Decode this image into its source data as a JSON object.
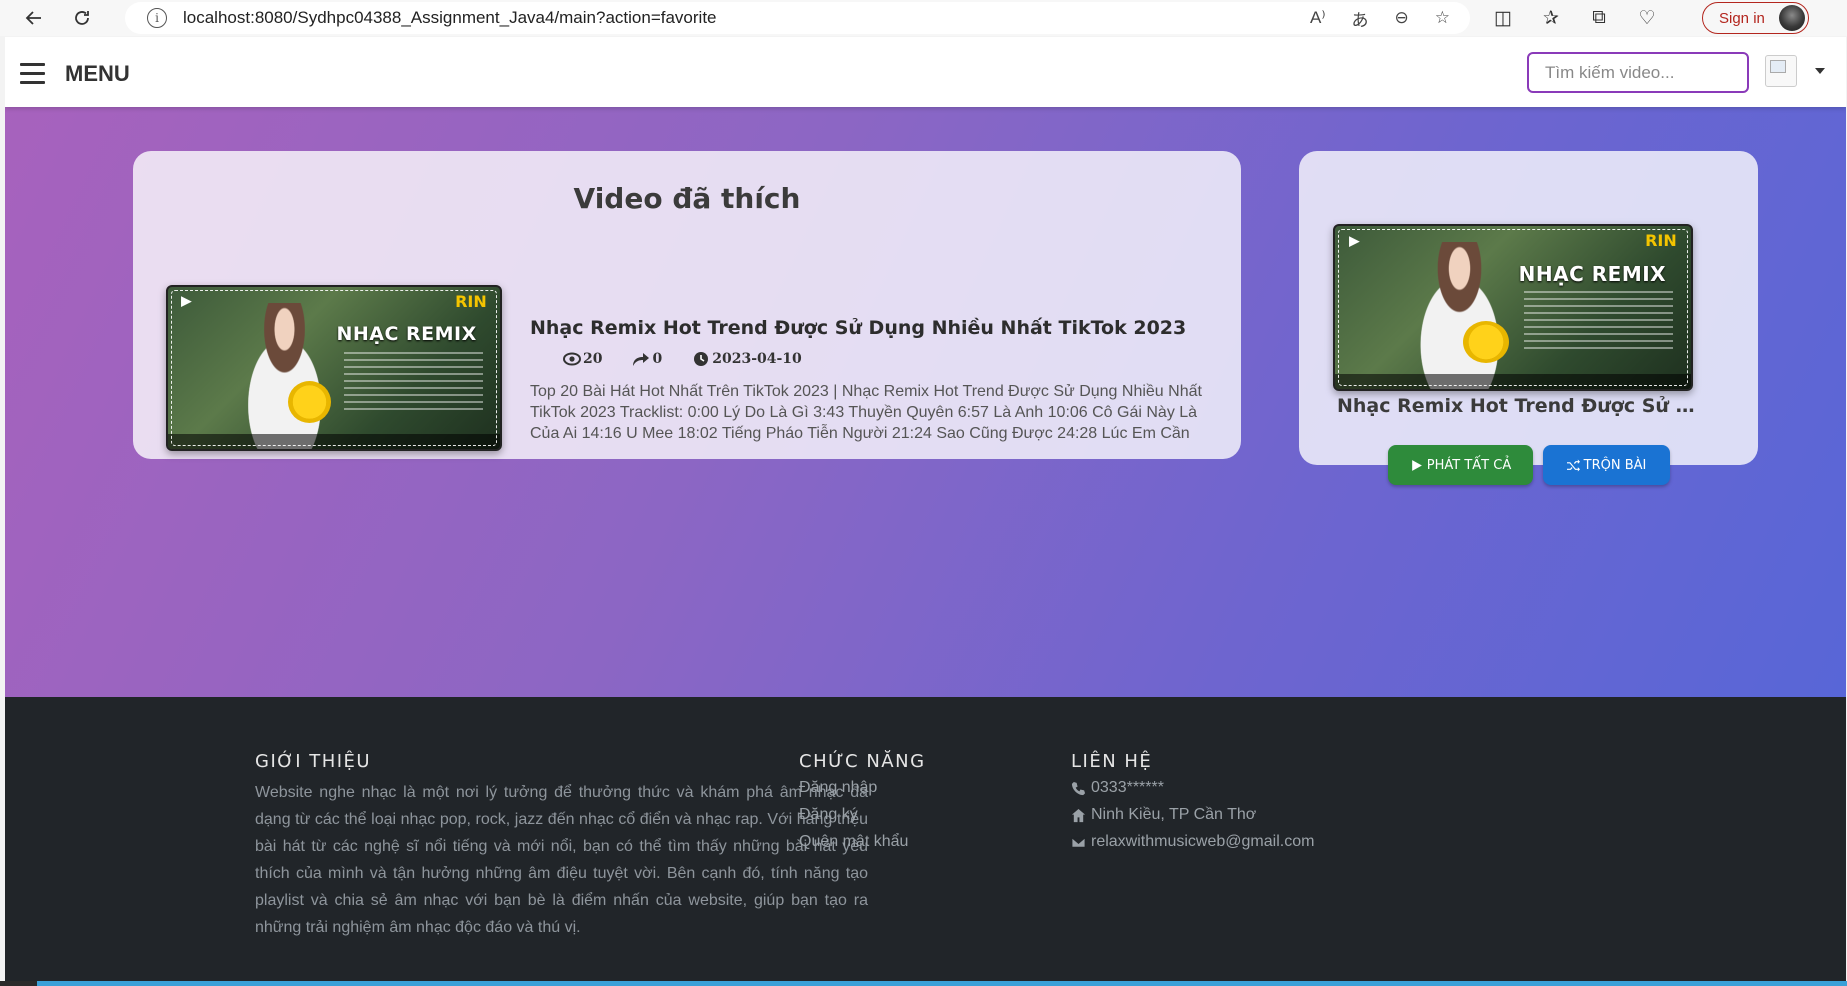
{
  "browser": {
    "url": "localhost:8080/Sydhpc04388_Assignment_Java4/main?action=favorite",
    "signin_label": "Sign in"
  },
  "navbar": {
    "menu_label": "MENU",
    "search_placeholder": "Tìm kiếm video..."
  },
  "favorites": {
    "heading": "Video đã thích",
    "video": {
      "thumbnail_title": "NHẠC REMIX",
      "thumbnail_brand": "RIN",
      "title": "Nhạc Remix Hot Trend Được Sử Dụng Nhiều Nhất TikTok 2023",
      "views": "20",
      "shares": "0",
      "date": "2023-04-10",
      "description": "Top 20 Bài Hát Hot Nhất Trên TikTok 2023 | Nhạc Remix Hot Trend Được Sử Dụng Nhiều Nhất TikTok 2023 Tracklist: 0:00 Lý Do Là Gì 3:43 Thuyền Quyên 6:57 Là Anh 10:06 Cô Gái Này Là Của Ai 14:16 U Mee 18:02 Tiếng Pháo Tiễn Người 21:24 Sao Cũng Được 24:28 Lúc Em Cần Anh Đang..."
    }
  },
  "playlist": {
    "title": "Nhạc Remix Hot Trend Được Sử Dụn...",
    "play_all_label": "PHÁT TẤT CẢ",
    "shuffle_label": "TRỘN BÀI"
  },
  "footer": {
    "about_heading": "GIỚI THIỆU",
    "about_text": "Website nghe nhạc là một nơi lý tưởng để thưởng thức và khám phá âm nhạc đa dạng từ các thể loại nhạc pop, rock, jazz đến nhạc cổ điển và nhạc rap. Với hàng triệu bài hát từ các nghệ sĩ nổi tiếng và mới nổi, bạn có thể tìm thấy những bài hát yêu thích của mình và tận hưởng những âm điệu tuyệt vời. Bên cạnh đó, tính năng tạo playlist và chia sẻ âm nhạc với bạn bè là điểm nhấn của website, giúp bạn tạo ra những trải nghiệm âm nhạc độc đáo và thú vị.",
    "features_heading": "CHỨC NĂNG",
    "features": [
      "Đăng nhập",
      "Đăng ký",
      "Quên mật khẩu"
    ],
    "contact_heading": "LIÊN HỆ",
    "contact": {
      "phone": "0333******",
      "address": "Ninh Kiều, TP Cần Thơ",
      "email": "relaxwithmusicweb@gmail.com"
    }
  },
  "colors": {
    "accent_purple": "#8a3ab9",
    "play_button": "#2e8b3b",
    "shuffle_button": "#1a73d3",
    "footer_bg": "#212529"
  }
}
